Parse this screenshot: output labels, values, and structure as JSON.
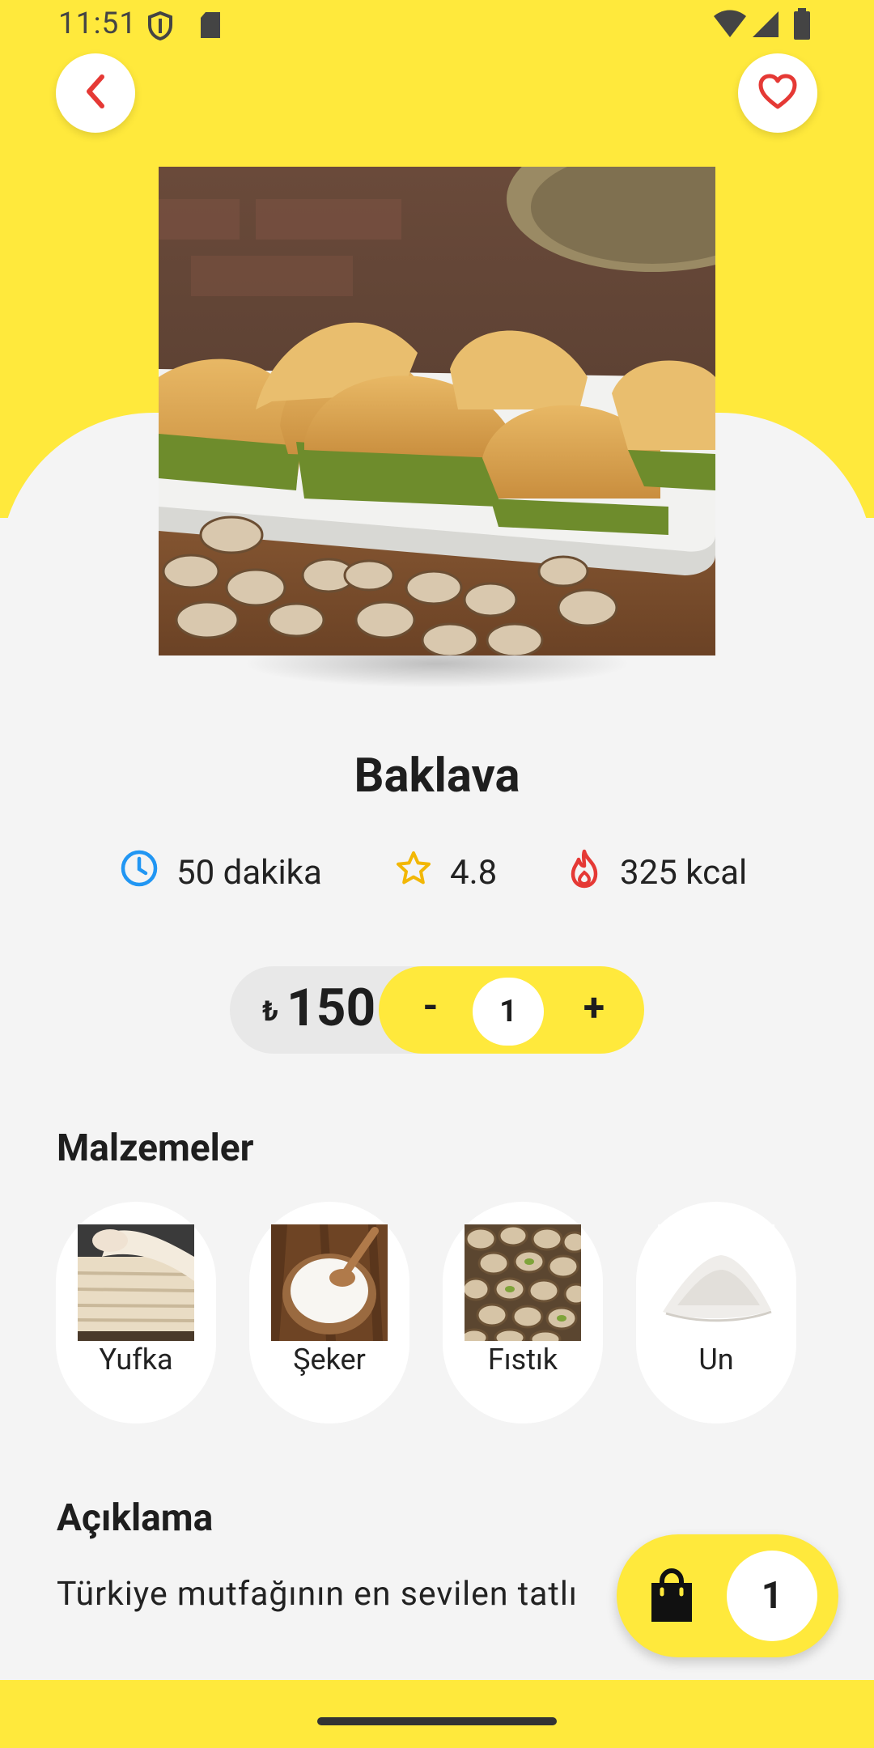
{
  "status_bar": {
    "time": "11:51"
  },
  "product": {
    "name": "Baklava",
    "stats": {
      "time": "50 dakika",
      "rating": "4.8",
      "calories": "325 kcal"
    },
    "currency": "₺",
    "price": "150",
    "quantity": "1",
    "minus_label": "-",
    "plus_label": "+"
  },
  "ingredients": {
    "title": "Malzemeler",
    "items": [
      {
        "label": "Yufka"
      },
      {
        "label": "Şeker"
      },
      {
        "label": "Fıstık"
      },
      {
        "label": "Un"
      }
    ]
  },
  "description": {
    "title": "Açıklama",
    "text": "Türkiye mutfağının en sevilen tatlı"
  },
  "cart": {
    "count": "1"
  },
  "colors": {
    "accent": "#FFE93C",
    "background": "#F4F4F4",
    "back_icon": "#E53935",
    "clock_icon": "#2196F3",
    "star_icon": "#F2B705",
    "fire_icon": "#E53935"
  },
  "icons": [
    "back-chevron-icon",
    "heart-icon",
    "clock-icon",
    "star-icon",
    "fire-icon",
    "shopping-bag-icon"
  ]
}
